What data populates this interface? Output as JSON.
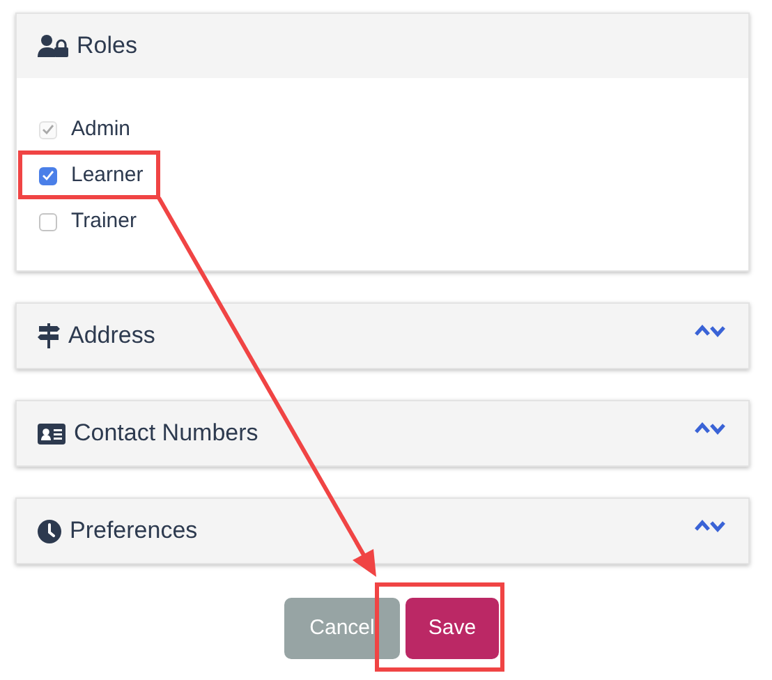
{
  "sections": [
    {
      "title": "Roles",
      "expanded": true,
      "roles": [
        {
          "label": "Admin",
          "checked": true,
          "disabled": true
        },
        {
          "label": "Learner",
          "checked": true,
          "disabled": false
        },
        {
          "label": "Trainer",
          "checked": false,
          "disabled": false
        }
      ]
    },
    {
      "title": "Address",
      "expanded": false
    },
    {
      "title": "Contact Numbers",
      "expanded": false
    },
    {
      "title": "Preferences",
      "expanded": false
    }
  ],
  "buttons": [
    {
      "label": "Cancel",
      "kind": "secondary"
    },
    {
      "label": "Save",
      "kind": "primary"
    }
  ]
}
